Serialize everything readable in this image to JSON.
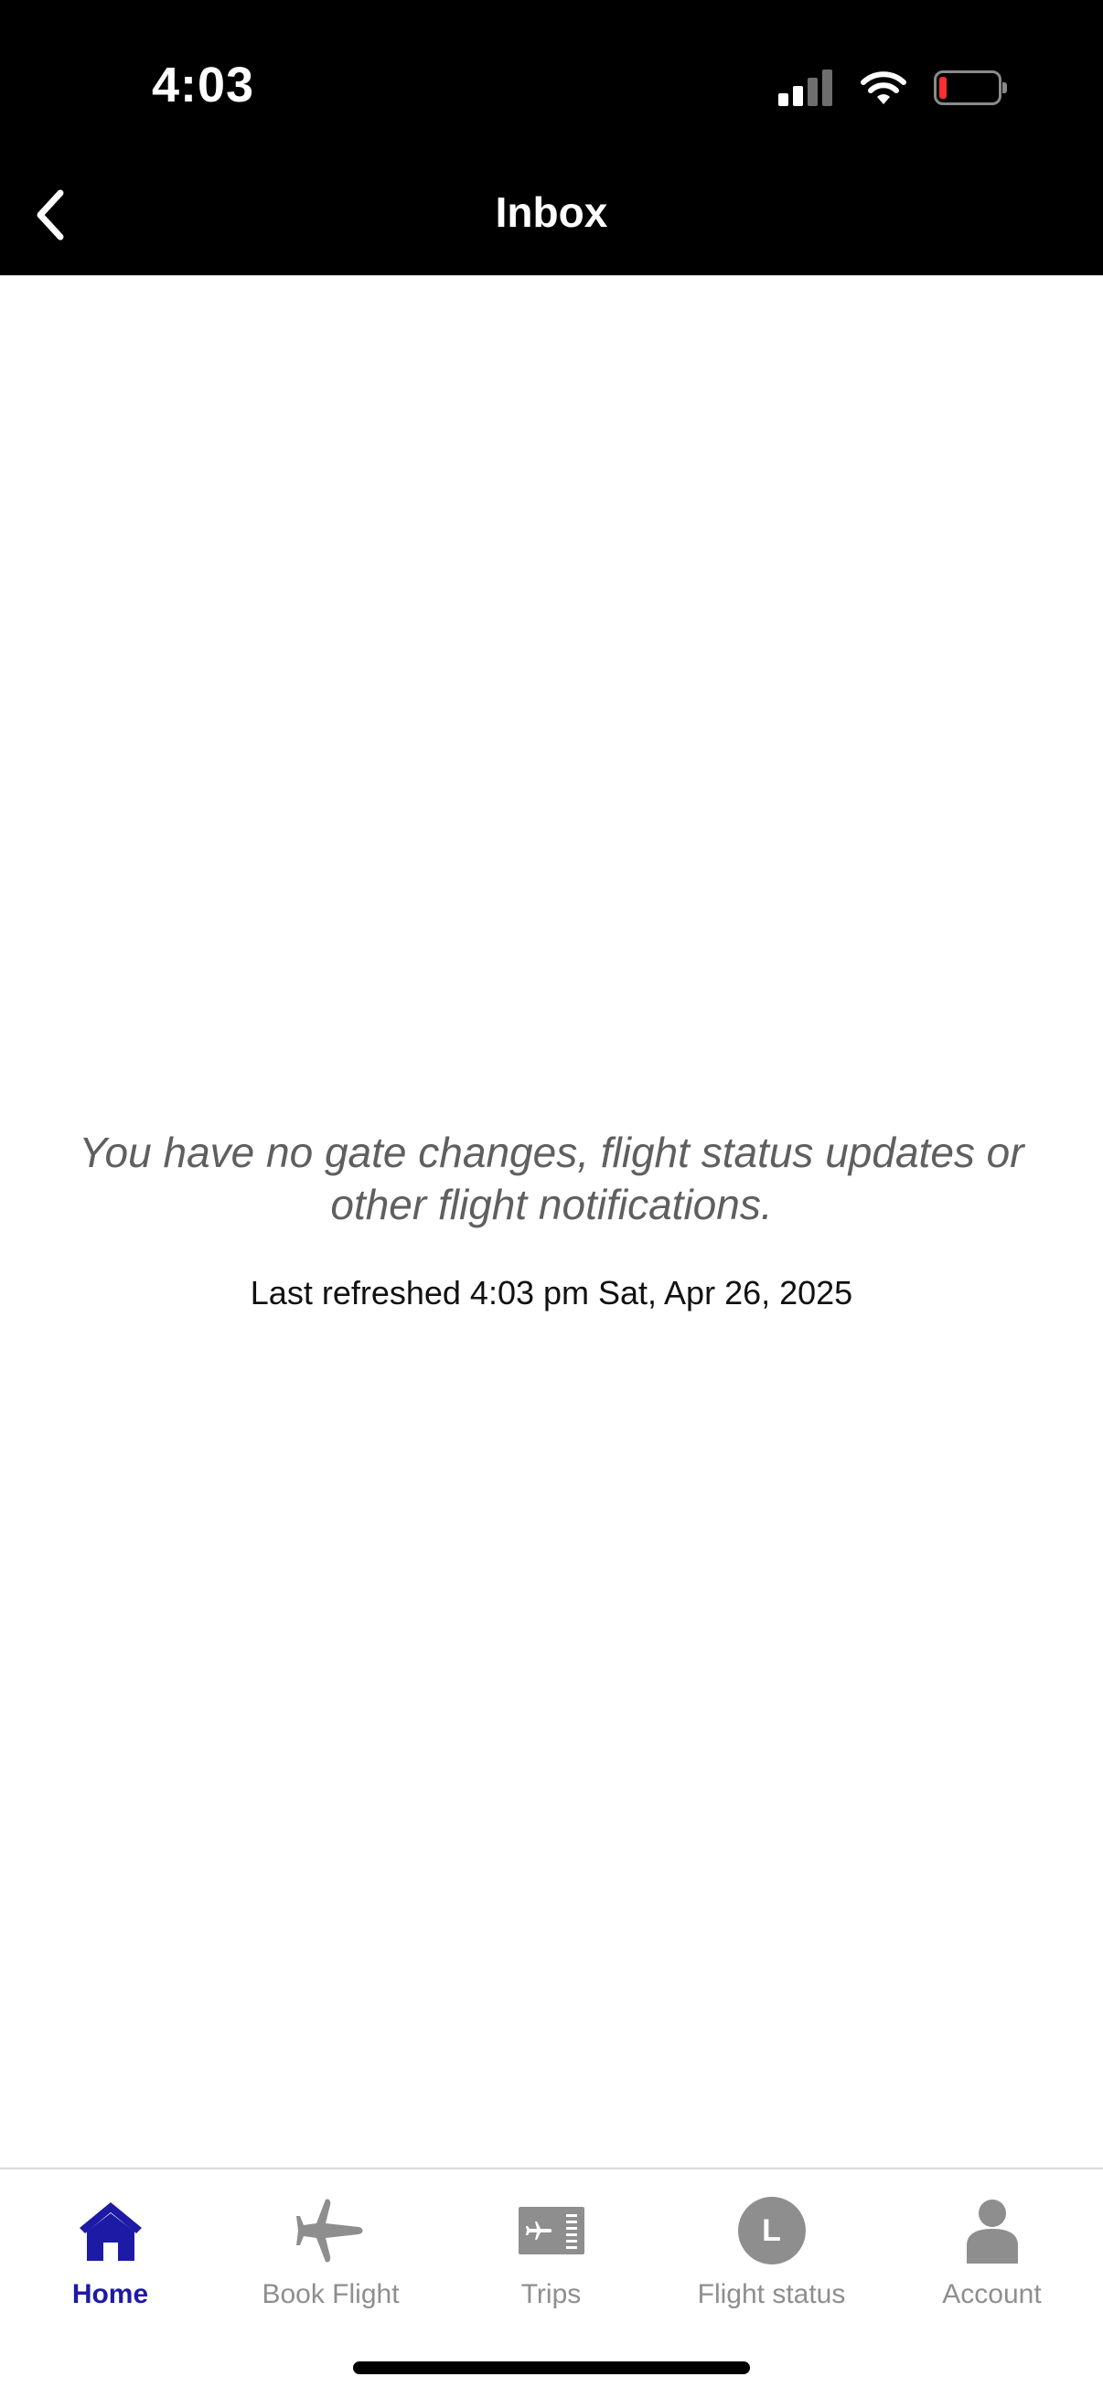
{
  "status_bar": {
    "time": "4:03"
  },
  "header": {
    "title": "Inbox",
    "back_icon": "chevron-left-icon"
  },
  "content": {
    "empty_message": "You have no gate changes, flight status updates or other flight notifications.",
    "last_refreshed": "Last refreshed 4:03 pm Sat, Apr 26, 2025"
  },
  "tabs": [
    {
      "label": "Home",
      "icon": "home-icon",
      "active": true
    },
    {
      "label": "Book Flight",
      "icon": "airplane-icon",
      "active": false
    },
    {
      "label": "Trips",
      "icon": "ticket-icon",
      "active": false
    },
    {
      "label": "Flight status",
      "icon": "flight-status-icon",
      "active": false,
      "badge": "L"
    },
    {
      "label": "Account",
      "icon": "person-icon",
      "active": false
    }
  ],
  "colors": {
    "header_bg": "#000000",
    "active_tab": "#1d1aa6",
    "inactive_tab": "#8e8e8e",
    "battery_low": "#ff2d2d"
  }
}
